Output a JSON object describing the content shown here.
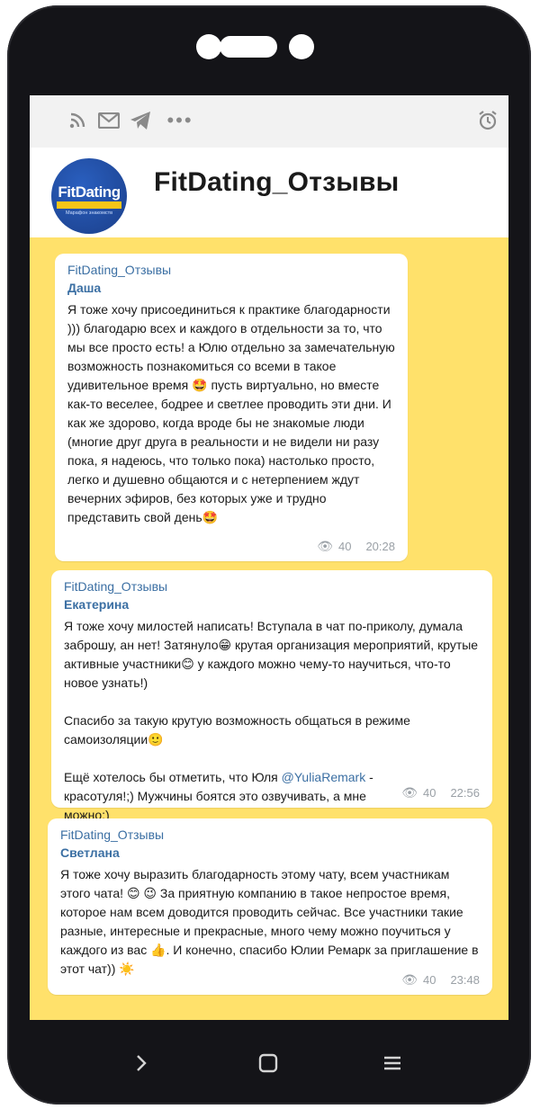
{
  "topbar": {
    "icons": [
      "rss-icon",
      "mail-icon",
      "telegram-icon",
      "more-icon",
      "alarm-icon"
    ]
  },
  "header": {
    "logo_text": "FitDating",
    "logo_subtitle": "Марафон знакомств",
    "title": "FitDating_Отзывы"
  },
  "messages": [
    {
      "forwarded_from": "FitDating_Отзывы",
      "author": "Даша",
      "text": "Я тоже хочу присоединиться к практике благодарности ))) благодарю всех и каждого в отдельности за то, что мы все просто есть! а Юлю отдельно за замечательную возможность познакомиться со всеми в такое удивительное время 🤩 пусть виртуально, но вместе как-то веселее, бодрее и светлее проводить эти дни. И как же здорово, когда вроде бы не знакомые люди (многие друг друга в реальности и не видели ни разу пока, я надеюсь, что только пока) настолько просто, легко и душевно общаются и с нетерпением ждут вечерних эфиров, без которых уже и трудно представить свой день🤩",
      "views": "40",
      "time": "20:28"
    },
    {
      "forwarded_from": "FitDating_Отзывы",
      "author": "Екатерина",
      "text_1": "Я тоже хочу милостей написать! Вступала в чат по-приколу, думала заброшу, ан нет! Затянуло😁 крутая организация мероприятий, крутые активные участники😊 у каждого можно чему-то научиться, что-то новое узнать!)",
      "text_2": "Спасибо за такую крутую возможность общаться в режиме самоизоляции🙂",
      "text_3_before": "Ещё хотелось бы отметить, что Юля ",
      "mention": "@YuliaRemark",
      "text_3_after": " - красотуля!;) Мужчины боятся это озвучивать, а мне можно;)",
      "views": "40",
      "time": "22:56"
    },
    {
      "forwarded_from": "FitDating_Отзывы",
      "author": "Светлана",
      "text": "Я тоже хочу выразить благодарность этому чату, всем участникам этого чата! 😊 😉 За приятную компанию в такое непростое время, которое нам всем доводится проводить сейчас. Все участники такие разные, интересные и прекрасные, много чему можно поучиться у каждого из вас 👍. И конечно, спасибо Юлии Ремарк за приглашение в этот чат)) ☀️",
      "views": "40",
      "time": "23:48"
    }
  ],
  "navbar": {
    "icons": [
      "back-icon",
      "home-icon",
      "menu-icon"
    ]
  },
  "colors": {
    "chat_background": "#ffe16b",
    "link": "#3b6fa3",
    "phone_frame": "#141418"
  }
}
